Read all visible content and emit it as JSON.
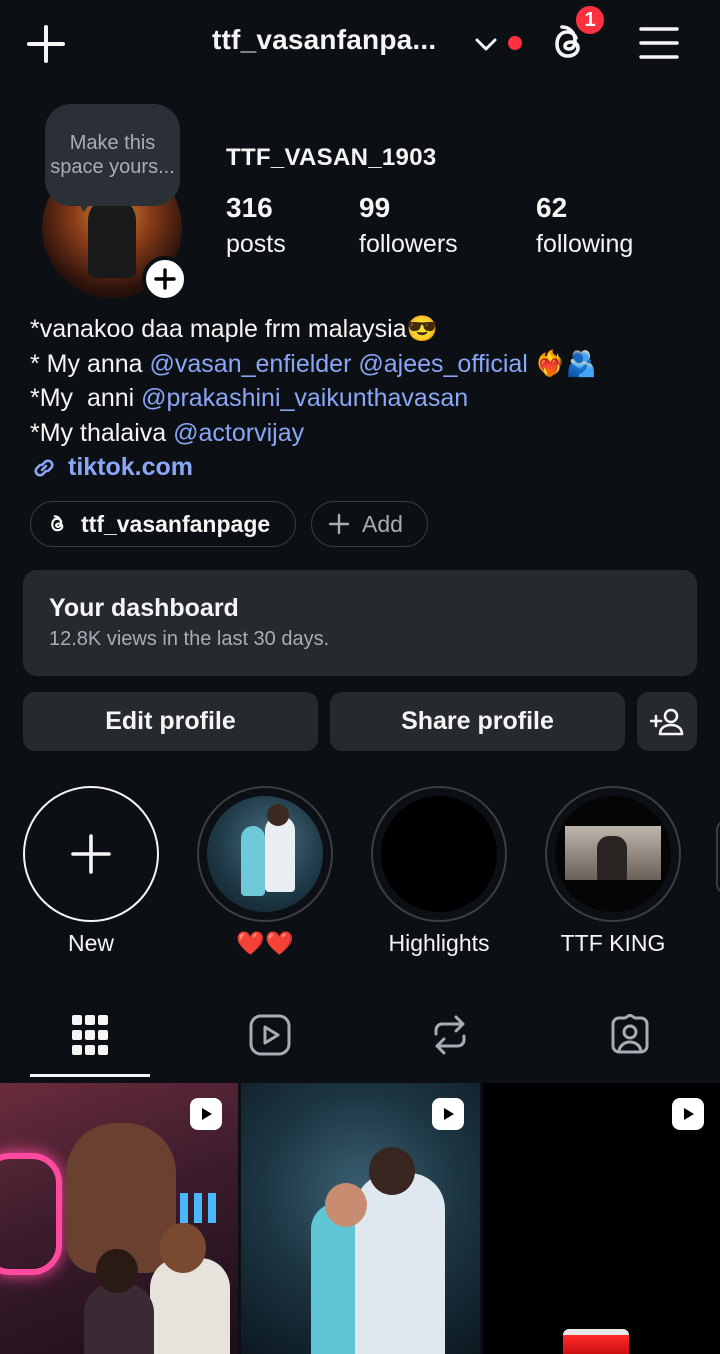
{
  "header": {
    "username": "ttf_vasanfanpa...",
    "threads_badge": "1"
  },
  "profile": {
    "bubble_text": "Make this space yours...",
    "name": "TTF_VASAN_1903",
    "stats": [
      {
        "value": "316",
        "label": "posts"
      },
      {
        "value": "99",
        "label": "followers"
      },
      {
        "value": "62",
        "label": "following"
      }
    ],
    "bio": {
      "line1": "*vanakoo daa maple frm malaysia😎",
      "line2_prefix": "* My anna ",
      "line2_mention1": "@vasan_enfielder",
      "line2_mention2": "@ajees_official",
      "line2_emoji": "❤️‍🔥🫂",
      "line3_prefix": "*My  anni ",
      "line3_mention": "@prakashini_vaikunthavasan",
      "line4_prefix": "*My thalaiva ",
      "line4_mention": "@actorvijay"
    },
    "link": "tiktok.com",
    "chips": {
      "threads": "ttf_vasanfanpage",
      "add": "Add"
    }
  },
  "dashboard": {
    "title": "Your dashboard",
    "subtitle": "12.8K views in the last 30 days."
  },
  "buttons": {
    "edit": "Edit profile",
    "share": "Share profile"
  },
  "highlights": [
    {
      "label": "New"
    },
    {
      "label": "❤️❤️"
    },
    {
      "label": "Highlights"
    },
    {
      "label": "TTF KING"
    }
  ],
  "icons": {
    "plus": "plus-icon",
    "chevron": "chevron-down-icon",
    "threads": "threads-icon",
    "menu": "hamburger-menu-icon",
    "link": "link-icon",
    "add_user": "add-user-icon",
    "grid": "grid-icon",
    "reels": "reels-icon",
    "reposts": "repost-icon",
    "tagged": "tagged-icon",
    "reel_badge": "play-icon"
  },
  "colors": {
    "background": "#0c1014",
    "card": "#262a2f",
    "mention": "#8aa7f7",
    "notification": "#ff3040"
  }
}
